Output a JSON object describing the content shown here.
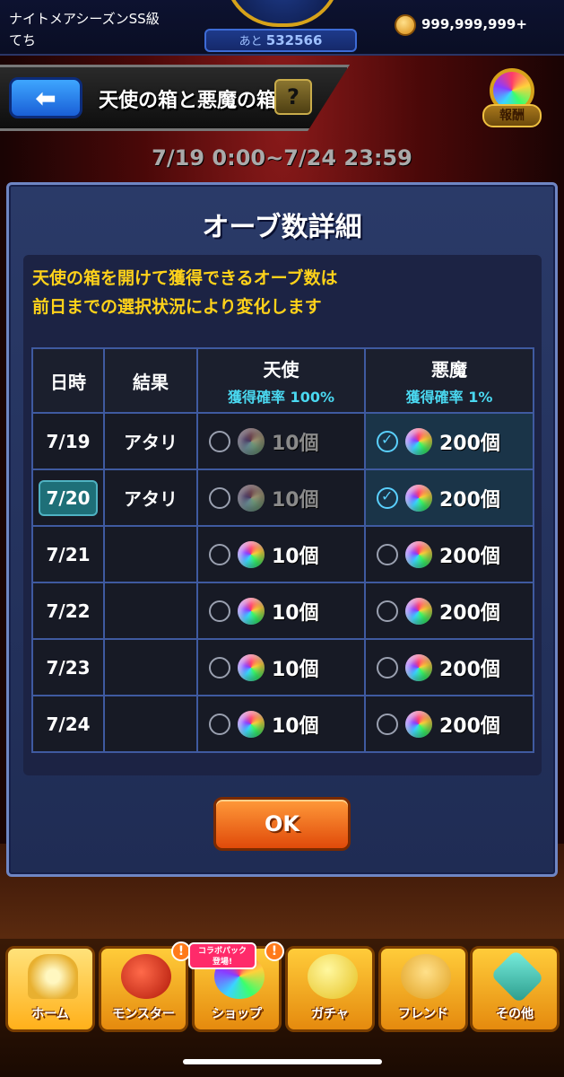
{
  "header": {
    "league": "ナイトメアシーズンSS級",
    "username": "てち",
    "rank_prefix": "あと",
    "rank_remaining": "532566",
    "coins": "999,999,999+"
  },
  "titlebar": {
    "title": "天使の箱と悪魔の箱",
    "help_label": "?",
    "reward_label": "報酬"
  },
  "period": "7/19 0:00~7/24 23:59",
  "dialog": {
    "title": "オーブ数詳細",
    "notice_line1": "天使の箱を開けて獲得できるオーブ数は",
    "notice_line2": "前日までの選択状況により変化します",
    "columns": {
      "date": "日時",
      "result": "結果",
      "angel": "天使",
      "angel_prob": "獲得確率 100%",
      "devil": "悪魔",
      "devil_prob": "獲得確率 1%"
    },
    "rows": [
      {
        "date": "7/19",
        "result": "アタリ",
        "angel": "10個",
        "devil": "200個"
      },
      {
        "date": "7/20",
        "result": "アタリ",
        "angel": "10個",
        "devil": "200個"
      },
      {
        "date": "7/21",
        "result": "",
        "angel": "10個",
        "devil": "200個"
      },
      {
        "date": "7/22",
        "result": "",
        "angel": "10個",
        "devil": "200個"
      },
      {
        "date": "7/23",
        "result": "",
        "angel": "10個",
        "devil": "200個"
      },
      {
        "date": "7/24",
        "result": "",
        "angel": "10個",
        "devil": "200個"
      }
    ],
    "ok_label": "OK"
  },
  "nav": {
    "home": "ホーム",
    "monster": "モンスター",
    "shop": "ショップ",
    "gacha": "ガチャ",
    "friend": "フレンド",
    "other": "その他",
    "collab_line1": "コラボパック",
    "collab_line2": "登場!",
    "badge": "!"
  },
  "colors": {
    "notice": "#ffd21a",
    "probability": "#4ad8f0",
    "table_border": "#3f5aa0",
    "ok_button": "#f06a1a"
  }
}
